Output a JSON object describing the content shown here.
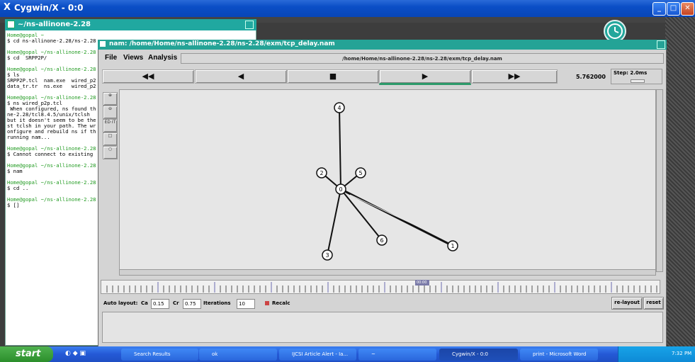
{
  "window": {
    "title": "Cygwin/X - 0:0"
  },
  "xterm": {
    "title": "~/ns-allinone-2.28",
    "lines": [
      {
        "t": "Home@gopal ~",
        "c": "g"
      },
      {
        "t": "$ cd ns-allinone-2.28/ns-2.28",
        "c": ""
      },
      {
        "t": "",
        "c": ""
      },
      {
        "t": "Home@gopal ~/ns-allinone-2.28",
        "c": "g"
      },
      {
        "t": "$ cd  SRPP2P/",
        "c": ""
      },
      {
        "t": "",
        "c": ""
      },
      {
        "t": "Home@gopal ~/ns-allinone-2.28",
        "c": "g"
      },
      {
        "t": "$ ls",
        "c": ""
      },
      {
        "t": "SRPP2P.tcl  nam.exe  wired_p2",
        "c": ""
      },
      {
        "t": "data_tr.tr  ns.exe   wired_p2",
        "c": ""
      },
      {
        "t": "",
        "c": ""
      },
      {
        "t": "Home@gopal ~/ns-allinone-2.28",
        "c": "g"
      },
      {
        "t": "$ ns wired_p2p.tcl",
        "c": ""
      },
      {
        "t": " When configured, ns found th",
        "c": ""
      },
      {
        "t": "ne-2.28/tcl8.4.5/unix/tclsh",
        "c": ""
      },
      {
        "t": "but it doesn't seem to be the",
        "c": ""
      },
      {
        "t": "st tclsh in your path. The wr",
        "c": ""
      },
      {
        "t": "onfigure and rebuild ns if th",
        "c": ""
      },
      {
        "t": "running nam...",
        "c": ""
      },
      {
        "t": "",
        "c": ""
      },
      {
        "t": "Home@gopal ~/ns-allinone-2.28",
        "c": "g"
      },
      {
        "t": "$ Cannot connect to existing",
        "c": ""
      },
      {
        "t": "",
        "c": ""
      },
      {
        "t": "Home@gopal ~/ns-allinone-2.28",
        "c": "g"
      },
      {
        "t": "$ nam",
        "c": ""
      },
      {
        "t": "",
        "c": ""
      },
      {
        "t": "Home@gopal ~/ns-allinone-2.28",
        "c": "g"
      },
      {
        "t": "$ cd ..",
        "c": ""
      },
      {
        "t": "",
        "c": ""
      },
      {
        "t": "Home@gopal ~/ns-allinone-2.28",
        "c": "g"
      },
      {
        "t": "$ []",
        "c": ""
      }
    ]
  },
  "nam": {
    "title": "nam: /home/Home/ns-allinone-2.28/ns-2.28/exm/tcp_delay.nam",
    "menus": [
      "File",
      "Views",
      "Analysis"
    ],
    "file_path": "/home/Home/ns-allinone-2.28/ns-2.28/exm/tcp_delay.nam",
    "controls": {
      "rewind": "◀◀",
      "back": "◀",
      "stop": "■",
      "play": "▶",
      "ff": "▶▶"
    },
    "time": "5.762000",
    "step_label": "Step: 2.0ms",
    "palette": [
      "zoom-in-icon",
      "zoom-out-icon",
      "edit-icon",
      "square-icon",
      "circle-icon"
    ],
    "edit_label": "ED IT",
    "nodes": [
      "0",
      "1",
      "2",
      "3",
      "4",
      "5",
      "6"
    ],
    "timeline_marker_text": "00:00",
    "auto_layout": {
      "label": "Auto layout:",
      "ca_label": "Ca",
      "ca_value": "0.15",
      "cr_label": "Cr",
      "cr_value": "0.75",
      "iter_label": "Iterations",
      "iter_value": "10",
      "recalc_label": "Recalc",
      "relayout": "re-layout",
      "reset": "reset"
    }
  },
  "taskbar": {
    "start": "start",
    "tasks": [
      {
        "label": "Search Results",
        "active": false
      },
      {
        "label": "ok",
        "active": false
      },
      {
        "label": "IJCSI Article Alert - Ia...",
        "active": false
      },
      {
        "label": "~",
        "active": false
      },
      {
        "label": "Cygwin/X - 0:0",
        "active": true
      },
      {
        "label": "print - Microsoft Word",
        "active": false
      }
    ],
    "clock": "7:32 PM"
  }
}
